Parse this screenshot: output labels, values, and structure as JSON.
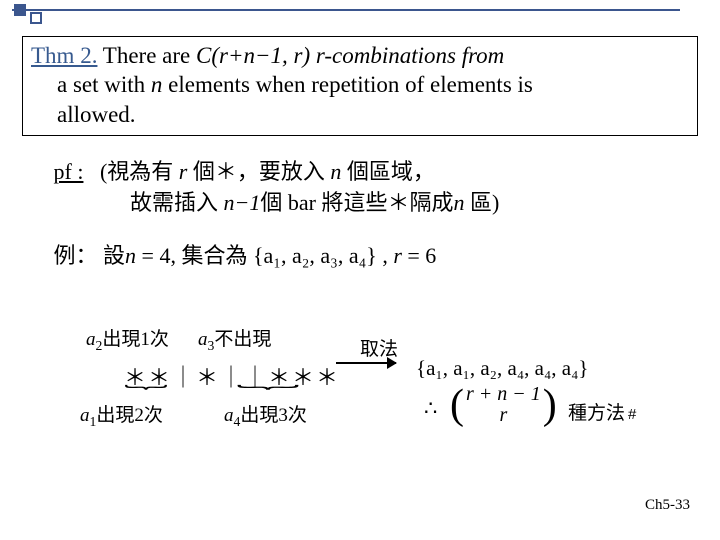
{
  "theorem": {
    "label": "Thm 2.",
    "line1_part1": "There are  ",
    "formula": "C(r+n−1, r)",
    "line1_part2": " r-combinations from",
    "line2": "a set with ",
    "n": "n",
    "line2b": " elements when repetition of elements is",
    "line3": "allowed."
  },
  "proof": {
    "label": "pf :",
    "line1a": "(視為有 ",
    "r": "r",
    "line1b": " 個＊，要放入 ",
    "n": "n",
    "line1c": " 個區域，",
    "line2a": "故需插入 ",
    "nm1": "n−1",
    "line2b": "個 bar 將這些＊隔成",
    "n2": "n",
    "line2c": " 區)"
  },
  "example": {
    "label": "例：",
    "setn": "設",
    "n": "n",
    "eq4": " = 4,  集合為 ",
    "set_expr": "{a₁, a₂, a₃, a₄}",
    "comma_r": " , ",
    "r": "r",
    "eq6": " = 6"
  },
  "diagram": {
    "a2_note": "出現1次",
    "a3_note": "不出現",
    "sequence": "＊＊｜＊｜｜＊＊＊",
    "a1_note": "出現2次",
    "a4_note": "出現3次",
    "taking": "取法",
    "result_set": "{a₁, a₁, a₂, a₄, a₄, a₄}",
    "therefore": "∴",
    "binom_top": "r + n − 1",
    "binom_bot": "r",
    "ways": "種方法",
    "hash": "#"
  },
  "labels": {
    "a1": "a",
    "s1": "1",
    "a2": "a",
    "s2": "2",
    "a3": "a",
    "s3": "3",
    "a4": "a",
    "s4": "4"
  },
  "page": "Ch5-33"
}
